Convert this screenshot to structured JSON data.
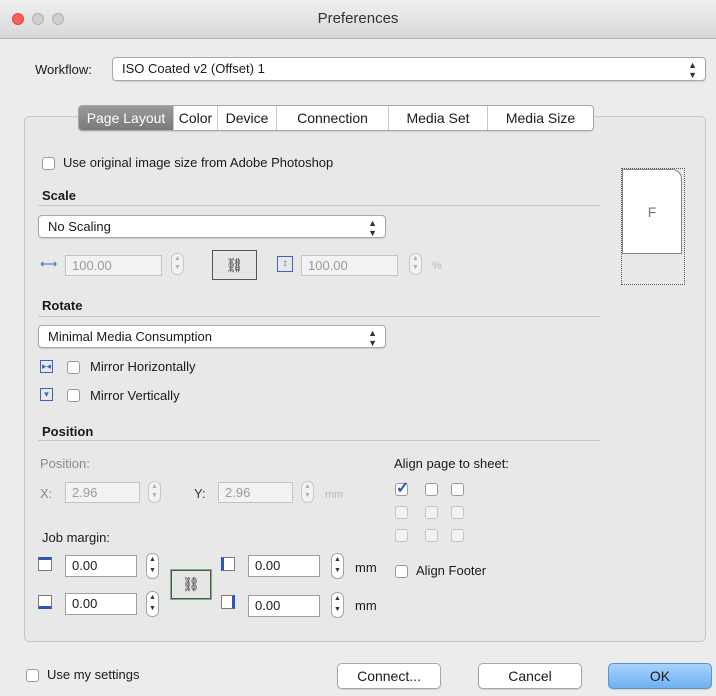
{
  "window": {
    "title": "Preferences"
  },
  "workflow": {
    "label": "Workflow:",
    "value": "ISO Coated v2 (Offset) 1"
  },
  "tabs": [
    {
      "label": "Page Layout",
      "selected": true
    },
    {
      "label": "Color"
    },
    {
      "label": "Device"
    },
    {
      "label": "Connection"
    },
    {
      "label": "Media Set"
    },
    {
      "label": "Media Size"
    }
  ],
  "page_layout": {
    "use_original_size": {
      "label": "Use original image size from Adobe Photoshop",
      "checked": false
    },
    "preview_letter": "F",
    "scale": {
      "heading": "Scale",
      "popup_value": "No Scaling",
      "width_value": "100.00",
      "height_value": "100.00",
      "unit": "%"
    },
    "rotate": {
      "heading": "Rotate",
      "popup_value": "Minimal Media Consumption",
      "mirror_h": {
        "label": "Mirror Horizontally",
        "checked": false
      },
      "mirror_v": {
        "label": "Mirror Vertically",
        "checked": false
      }
    },
    "position": {
      "heading": "Position",
      "position_label": "Position:",
      "x_label": "X:",
      "x_value": "2.96",
      "y_label": "Y:",
      "y_value": "2.96",
      "unit": "mm",
      "align_label": "Align page to sheet:",
      "align_grid_checked_index": 0,
      "job_margin_label": "Job margin:",
      "margin_top": "0.00",
      "margin_bottom": "0.00",
      "margin_left": "0.00",
      "margin_right": "0.00",
      "margin_unit": "mm",
      "align_footer": {
        "label": "Align Footer",
        "checked": false
      }
    }
  },
  "footer": {
    "use_my_settings": {
      "label": "Use my settings",
      "checked": false
    },
    "connect_label": "Connect...",
    "cancel_label": "Cancel",
    "ok_label": "OK"
  },
  "colors": {
    "default_button": "#6fb1f3",
    "close_button": "#fc605b",
    "tab_selected": "#8a8a8a"
  }
}
